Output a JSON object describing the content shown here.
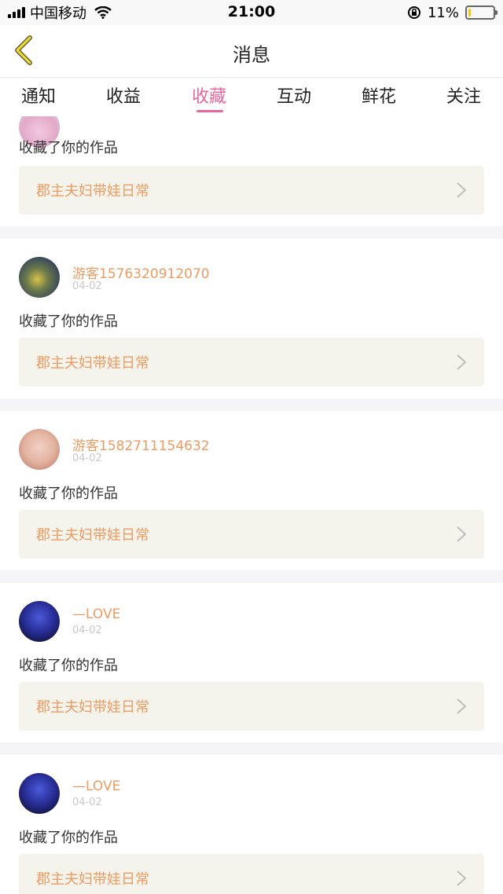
{
  "status_bar": {
    "carrier": "中国移动",
    "time": "21:00",
    "battery": "11%",
    "battery_level": 0.11,
    "icons": [
      "signal-icon",
      "wifi-icon",
      "orientation-lock-icon",
      "battery-icon"
    ]
  },
  "header": {
    "title": "消息",
    "back_icon": "chevron-left-icon"
  },
  "tabs": [
    {
      "label": "通知",
      "active": false
    },
    {
      "label": "收益",
      "active": false
    },
    {
      "label": "收藏",
      "active": true
    },
    {
      "label": "互动",
      "active": false
    },
    {
      "label": "鲜花",
      "active": false
    },
    {
      "label": "关注",
      "active": false
    }
  ],
  "colors": {
    "accent": "#e8679d",
    "username": "#ee9b62",
    "card_box": "#f4f4ec"
  },
  "messages": [
    {
      "user": "",
      "date": "",
      "action": "收藏了你的作品",
      "work": "郡主夫妇带娃日常"
    },
    {
      "user": "游客1576320912070",
      "date": "04-02",
      "action": "收藏了你的作品",
      "work": "郡主夫妇带娃日常"
    },
    {
      "user": "游客1582711154632",
      "date": "04-02",
      "action": "收藏了你的作品",
      "work": "郡主夫妇带娃日常"
    },
    {
      "user": "—LOVE",
      "date": "04-02",
      "action": "收藏了你的作品",
      "work": "郡主夫妇带娃日常"
    },
    {
      "user": "—LOVE",
      "date": "04-02",
      "action": "收藏了你的作品",
      "work": "郡主夫妇带娃日常"
    }
  ]
}
